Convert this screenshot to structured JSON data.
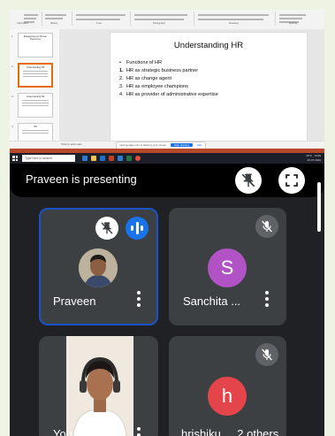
{
  "shared_screen": {
    "ribbon_groups": [
      "Clipboard",
      "Slides",
      "Font",
      "Paragraph",
      "Drawing",
      "Editing"
    ],
    "thumbnails": [
      {
        "num": "1",
        "title": "Management of Human Resources"
      },
      {
        "num": "2",
        "title": "Understanding HR"
      },
      {
        "num": "3",
        "title": "Understanding HR"
      },
      {
        "num": "4",
        "title": "HR"
      }
    ],
    "slide": {
      "title": "Understanding HR",
      "bullets": [
        {
          "marker": "•",
          "text": "Functions of HR"
        },
        {
          "marker": "1.",
          "text": "HR as strategic business partner"
        },
        {
          "marker": "2.",
          "text": "HR as change agent"
        },
        {
          "marker": "3.",
          "text": "HR as employee champions"
        },
        {
          "marker": "4.",
          "text": "HR as provider of administrative expertise"
        }
      ]
    },
    "notes_placeholder": "Click to add notes",
    "share_banner": {
      "text": "meet.google.com is sharing your screen.",
      "stop_label": "Stop sharing",
      "hide_label": "Hide"
    },
    "taskbar": {
      "search_placeholder": "Type here to search",
      "weather": "29°C",
      "time": "13:06",
      "date": "06-07-2022"
    }
  },
  "presenting_bar": {
    "text": "Praveen is presenting",
    "pin_icon": "pin-off-icon",
    "fullscreen_icon": "fullscreen-icon"
  },
  "tiles": [
    {
      "name": "Praveen",
      "avatar": "photo",
      "speaking": true,
      "active": true
    },
    {
      "name": "Sanchita ...",
      "avatar_letter": "S",
      "avatar_color": "#b153c4",
      "muted": true
    },
    {
      "name": "You",
      "camera": true
    },
    {
      "name": "hrishiku...",
      "avatar_letter": "h",
      "avatar_color": "#e4454b",
      "muted": true,
      "others_label": "2 others"
    }
  ],
  "colors": {
    "background": "#202124",
    "tile": "#3c4043",
    "active_border": "#1a52c7",
    "speaking": "#1a73e8"
  }
}
